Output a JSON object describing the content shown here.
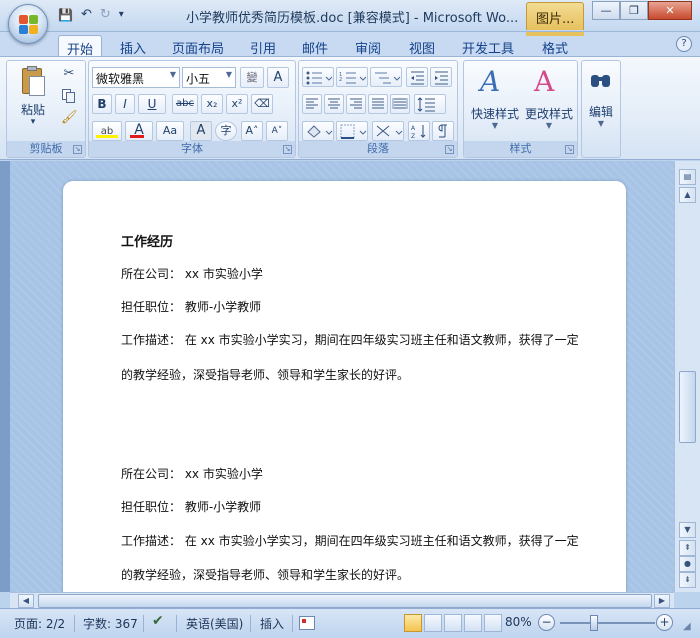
{
  "titlebar": {
    "title": "小学教师优秀简历模板.doc [兼容模式] - Microsoft Wo...",
    "context_tab": "图片...",
    "minimize": "—",
    "restore": "❐",
    "close": "✕"
  },
  "quick_access": {
    "save_icon": "💾",
    "undo_icon": "↶",
    "redo_icon": "↻",
    "customize_icon": "▾"
  },
  "tabs": [
    "开始",
    "插入",
    "页面布局",
    "引用",
    "邮件",
    "审阅",
    "视图",
    "开发工具",
    "格式"
  ],
  "help": "?",
  "ribbon": {
    "clipboard": {
      "label": "剪贴板",
      "paste": "粘贴",
      "paste_arrow": "▾"
    },
    "font": {
      "label": "字体",
      "font_name": "微软雅黑",
      "font_size": "小五",
      "buttons": [
        "B",
        "I",
        "U",
        "abc",
        "x₂",
        "x²",
        "Aa",
        "A",
        "A",
        "A"
      ],
      "wen": "變",
      "char_border": "A",
      "circle_char": "字",
      "grow": "A˄",
      "shrink": "A˅"
    },
    "paragraph": {
      "label": "段落"
    },
    "styles": {
      "label": "样式",
      "quick_styles": "快速样式",
      "change_styles": "更改样式"
    },
    "editing": {
      "label": "编辑"
    }
  },
  "document": {
    "heading": "工作经历",
    "blocks": [
      {
        "company": "所在公司： xx 市实验小学",
        "position": "担任职位： 教师-小学教师",
        "desc1": "工作描述： 在 xx 市实验小学实习，期间在四年级实习班主任和语文教师，获得了一定",
        "desc2": "的教学经验，深受指导老师、领导和学生家长的好评。"
      },
      {
        "company": "所在公司： xx 市实验小学",
        "position": "担任职位： 教师-小学教师",
        "desc1": "工作描述： 在 xx 市实验小学实习，期间在四年级实习班主任和语文教师，获得了一定",
        "desc2": "的教学经验，深受指导老师、领导和学生家长的好评。"
      }
    ]
  },
  "statusbar": {
    "page": "页面: 2/2",
    "words": "字数: 367",
    "language": "英语(美国)",
    "insert_mode": "插入",
    "zoom": "80%",
    "zoom_out": "−",
    "zoom_in": "+"
  },
  "colors": {
    "accent": "#15428b",
    "font_color_bar": "#e01b1b"
  }
}
